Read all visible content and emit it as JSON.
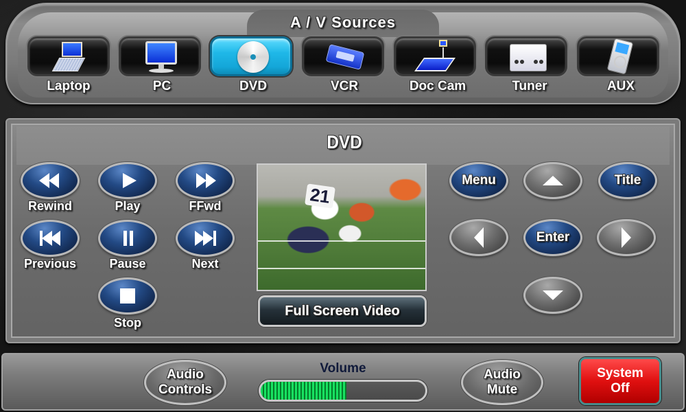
{
  "header": {
    "title": "A / V Sources"
  },
  "sources": [
    {
      "label": "Laptop",
      "icon": "laptop-icon",
      "active": false
    },
    {
      "label": "PC",
      "icon": "desktop-pc-icon",
      "active": false
    },
    {
      "label": "DVD",
      "icon": "disc-icon",
      "active": true
    },
    {
      "label": "VCR",
      "icon": "vhs-cassette-icon",
      "active": false
    },
    {
      "label": "Doc Cam",
      "icon": "document-camera-icon",
      "active": false
    },
    {
      "label": "Tuner",
      "icon": "tuner-icon",
      "active": false
    },
    {
      "label": "AUX",
      "icon": "media-player-icon",
      "active": false
    }
  ],
  "main": {
    "title": "DVD",
    "transport": {
      "rewind": "Rewind",
      "play": "Play",
      "ffwd": "FFwd",
      "previous": "Previous",
      "pause": "Pause",
      "next": "Next",
      "stop": "Stop"
    },
    "video": {
      "jersey_number": "21",
      "fullscreen_label": "Full Screen Video"
    },
    "nav": {
      "menu": "Menu",
      "title": "Title",
      "enter": "Enter"
    }
  },
  "footer": {
    "audio_controls_line1": "Audio",
    "audio_controls_line2": "Controls",
    "volume_label": "Volume",
    "volume_percent": 52,
    "audio_mute_line1": "Audio",
    "audio_mute_line2": "Mute",
    "system_off_line1": "System",
    "system_off_line2": "Off"
  },
  "colors": {
    "active_source": "#1fb8e8",
    "transport_button": "#234a85",
    "volume_fill": "#18e060",
    "system_off": "#e01010"
  }
}
